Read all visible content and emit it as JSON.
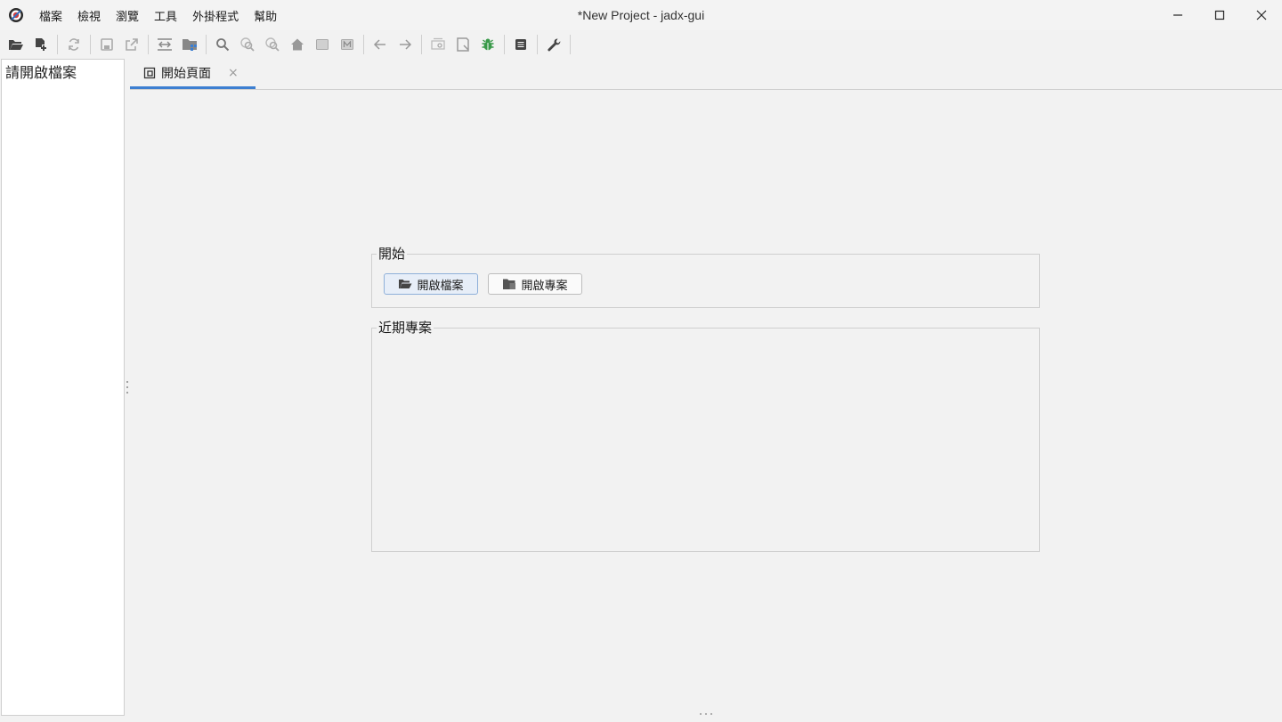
{
  "window": {
    "title": "*New Project - jadx-gui"
  },
  "menu": [
    "檔案",
    "檢視",
    "瀏覽",
    "工具",
    "外掛程式",
    "幫助"
  ],
  "toolbar": {
    "icons": [
      "open-file-icon",
      "add-files-icon",
      "reload-icon",
      "save-all-icon",
      "export-icon",
      "sync-tree-icon",
      "flatten-packages-icon",
      "search-icon",
      "find-class-icon",
      "find-usage-icon",
      "home-icon",
      "quark-icon",
      "method-icon",
      "back-icon",
      "forward-icon",
      "deobfuscation-icon",
      "decompile-all-icon",
      "debug-icon",
      "log-icon",
      "preferences-icon"
    ]
  },
  "left_panel": {
    "hint": "請開啟檔案"
  },
  "tabs": [
    {
      "label": "開始頁面",
      "close": "×"
    }
  ],
  "start_group": {
    "title": "開始",
    "open_file_label": "開啟檔案",
    "open_project_label": "開啟專案"
  },
  "recent_group": {
    "title": "近期專案",
    "items": []
  },
  "colors": {
    "accent": "#3d7fd1",
    "debug_green": "#3a9a4a"
  }
}
